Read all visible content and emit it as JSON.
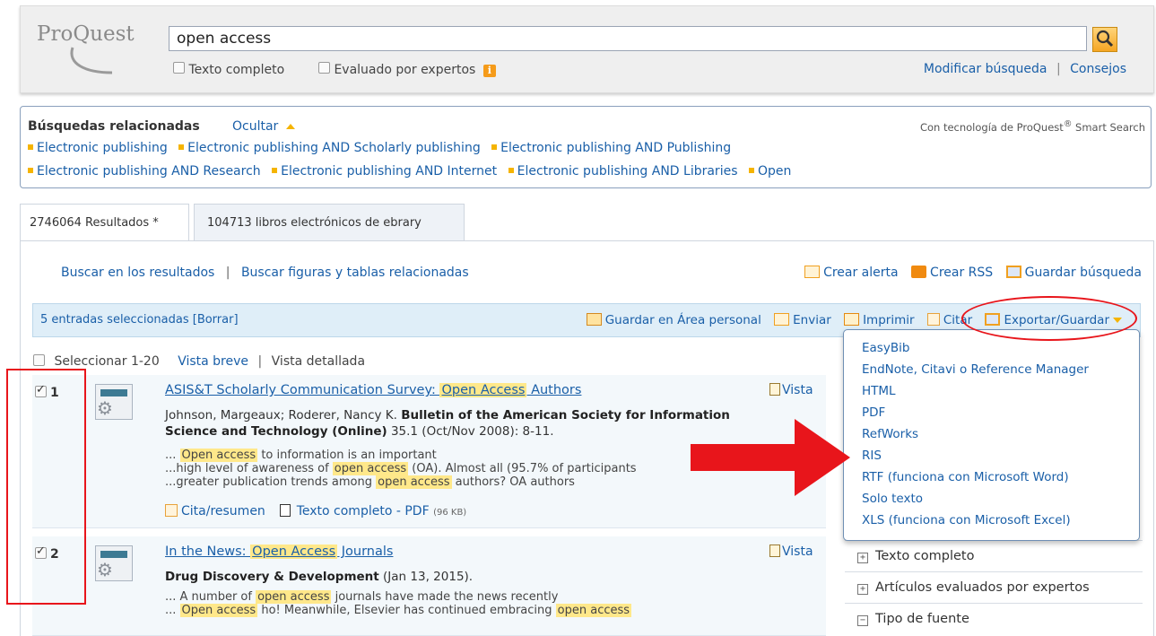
{
  "header": {
    "logo": "ProQuest",
    "search_value": "open access",
    "opt_fulltext": "Texto completo",
    "opt_peer": "Evaluado por expertos",
    "info_glyph": "i",
    "modify_link": "Modificar búsqueda",
    "tips_link": "Consejos",
    "separator": "|"
  },
  "related": {
    "title": "Búsquedas relacionadas",
    "hide": "Ocultar",
    "powered_prefix": "Con tecnología de ProQuest",
    "powered_reg": "®",
    "powered_suffix": " Smart Search",
    "row1": [
      "Electronic publishing",
      "Electronic publishing AND Scholarly publishing",
      "Electronic publishing AND Publishing"
    ],
    "row2": [
      "Electronic publishing AND Research",
      "Electronic publishing AND Internet",
      "Electronic publishing AND Libraries",
      "Open"
    ]
  },
  "tabs": {
    "results": "2746064 Resultados *",
    "ebooks": "104713 libros electrónicos de ebrary"
  },
  "sublinks": {
    "search_within": "Buscar en los resultados",
    "sep": "|",
    "figures": "Buscar figuras y tablas relacionadas",
    "alert": "Crear alerta",
    "rss": "Crear RSS",
    "save_search": "Guardar búsqueda"
  },
  "selbar": {
    "selected": "5 entradas seleccionadas [Borrar]",
    "save_area": "Guardar en Área personal",
    "send": "Enviar",
    "print": "Imprimir",
    "cite": "Citar",
    "export": "Exportar/Guardar"
  },
  "select_row": {
    "select": "Seleccionar 1-20",
    "brief": "Vista breve",
    "sep": "|",
    "detailed": "Vista detallada"
  },
  "results": [
    {
      "num": "1",
      "title_pre": "ASIS&T Scholarly Communication Survey: ",
      "title_hl": "Open Access",
      "title_post": " Authors",
      "view": "Vista",
      "authors": "Johnson, Margeaux; Roderer, Nancy K. ",
      "journal": "Bulletin of the American Society for Information Science and Technology (Online)",
      "issue": " 35.1  (Oct/Nov 2008): 8-11.",
      "snip1_pre": "... ",
      "snip1_hl": "Open access",
      "snip1_post": " to information is an important",
      "snip2_pre": "...high level of awareness of ",
      "snip2_hl": "open access",
      "snip2_post": " (OA). Almost all (95.7% of participants",
      "snip3_pre": "...greater publication trends among ",
      "snip3_hl": "open access",
      "snip3_post": " authors? OA authors",
      "cite_link": "Cita/resumen",
      "pdf_link": "Texto completo - PDF",
      "pdf_size": "(96 KB)"
    },
    {
      "num": "2",
      "title_pre": "In the News: ",
      "title_hl": "Open Access",
      "title_post": " Journals",
      "view": "Vista",
      "journal": "Drug Discovery & Development",
      "issue": " (Jan 13, 2015).",
      "snip1_pre": "... A number of ",
      "snip1_hl": "open access",
      "snip1_post": " journals have made the news recently",
      "snip2_pre": "... ",
      "snip2_hl": "Open access",
      "snip2_mid": " ho! Meanwhile, Elsevier has continued embracing ",
      "snip2_hl2": "open access"
    }
  ],
  "export_menu": [
    "EasyBib",
    "EndNote, Citavi o Reference Manager",
    "HTML",
    "PDF",
    "RefWorks",
    "RIS",
    "RTF (funciona con Microsoft Word)",
    "Solo texto",
    "XLS (funciona con Microsoft Excel)"
  ],
  "facets": {
    "fulltext": "Texto completo",
    "peer": "Artículos evaluados por expertos",
    "source": "Tipo de fuente",
    "plus": "+",
    "minus": "−"
  },
  "colors": {
    "annotation_red": "#e8151b",
    "link_blue": "#1a5fa8",
    "highlight": "#ffe88a"
  }
}
